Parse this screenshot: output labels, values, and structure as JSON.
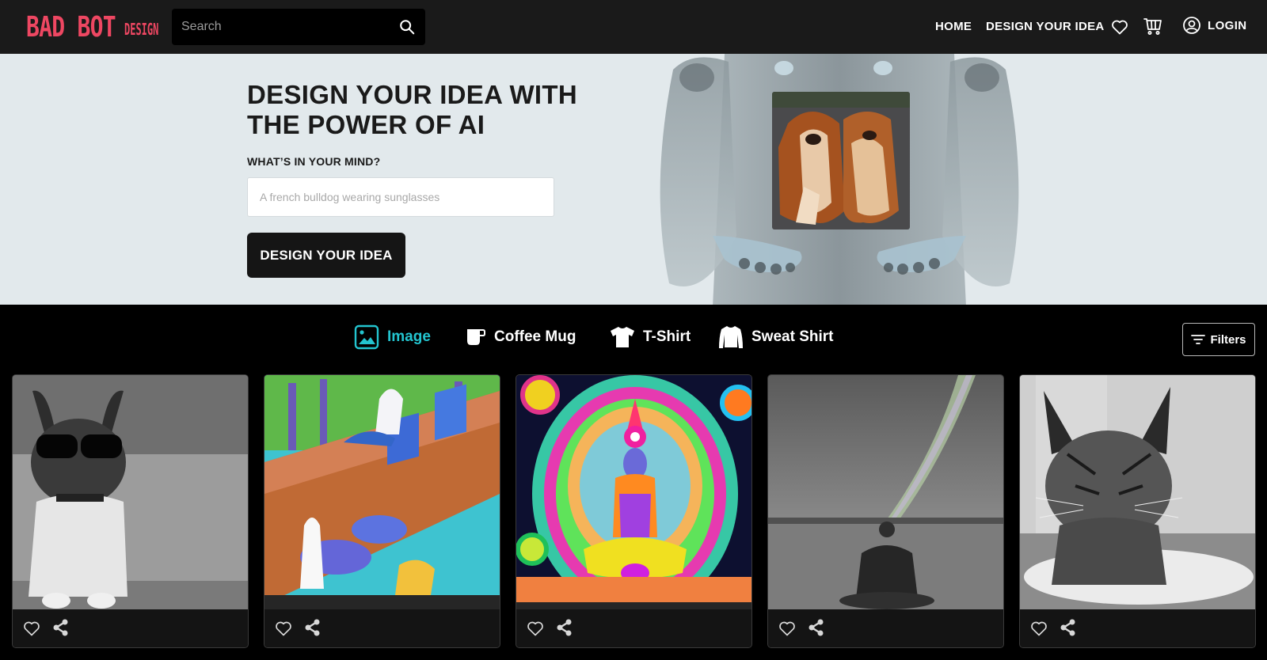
{
  "header": {
    "logo_main": "BAD BOT",
    "logo_sub": "DESIGN",
    "search_placeholder": "Search",
    "nav": {
      "home": "HOME",
      "design": "DESIGN YOUR IDEA",
      "login": "LOGIN"
    },
    "icons": [
      "search-icon",
      "heart-icon",
      "cart-icon",
      "user-circle-icon"
    ]
  },
  "hero": {
    "title": "DESIGN YOUR IDEA WITH THE POWER OF AI",
    "prompt_label": "WHAT’S IN YOUR MIND?",
    "prompt_placeholder": "A french bulldog wearing sunglasses",
    "button_label": "DESIGN YOUR IDEA",
    "showcase_image": "two long-haired brown dogs held by robot"
  },
  "categories": {
    "tabs": [
      {
        "label": "Image",
        "icon": "image-icon",
        "active": true
      },
      {
        "label": "Coffee Mug",
        "icon": "mug-icon",
        "active": false
      },
      {
        "label": "T-Shirt",
        "icon": "tshirt-icon",
        "active": false
      },
      {
        "label": "Sweat Shirt",
        "icon": "sweatshirt-icon",
        "active": false
      }
    ],
    "filters_label": "Filters",
    "active_color": "#23c4cf"
  },
  "gallery": {
    "cards": [
      {
        "image": "french bulldog wearing sunglasses (black & white)"
      },
      {
        "image": "watercolor cats on a wall"
      },
      {
        "image": "psychedelic meditating figure"
      },
      {
        "image": "man meditating under rainbow (black & white)"
      },
      {
        "image": "tabby cat on cushion (black & white)"
      }
    ],
    "actions": [
      "heart-icon",
      "share-icon"
    ]
  },
  "colors": {
    "brand": "#ee4762",
    "header_bg": "#1a1a1a",
    "hero_bg": "#e2e9ec",
    "accent": "#23c4cf"
  }
}
